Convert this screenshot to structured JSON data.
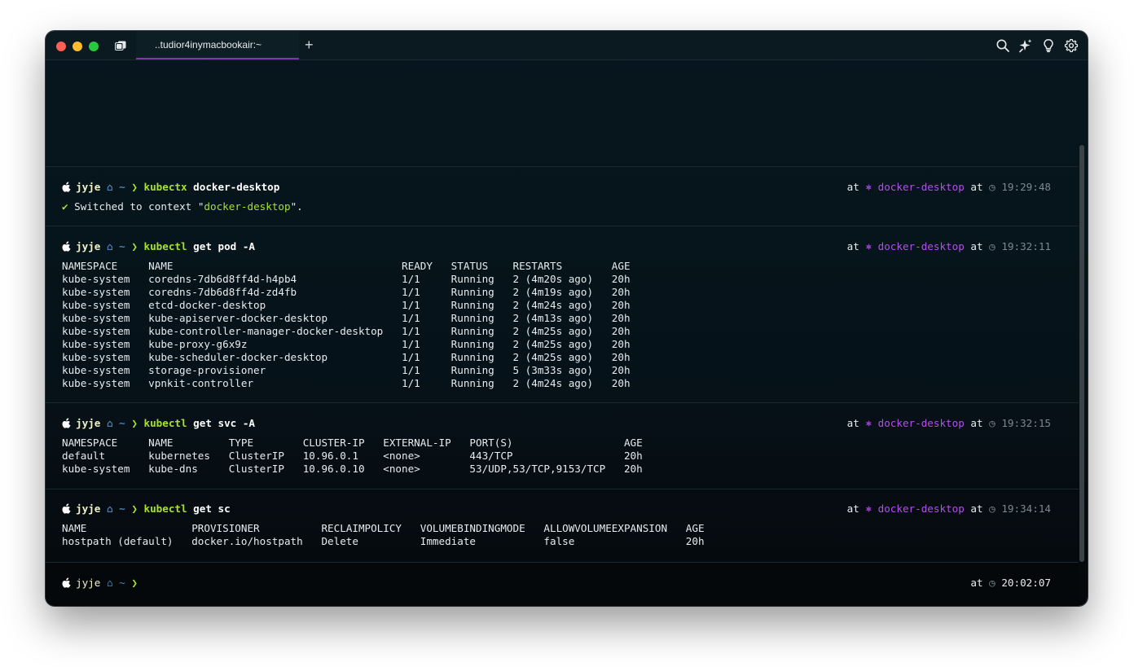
{
  "window": {
    "tab_title": "..tudior4inymacbookair:~",
    "new_tab_label": "+"
  },
  "toolbar_icons": [
    "search-icon",
    "sparkle-icon",
    "lightbulb-icon",
    "gear-icon"
  ],
  "colors": {
    "background": "#07171e",
    "prompt_user": "#f2f2c4",
    "command": "#a6e22e",
    "context": "#b350e8",
    "timestamp": "#7b8a90",
    "tab_underline": "#7c3aa6"
  },
  "prompt": {
    "user": "jyje",
    "home_glyph": "⌂",
    "tilde": "~",
    "chevron": "❯",
    "at": "at",
    "context_glyph": "⎈"
  },
  "blocks": [
    {
      "command": "kubectx",
      "args": "docker-desktop",
      "context": "docker-desktop",
      "time": "19:29:48",
      "output": {
        "check": "✔",
        "before": " Switched to context \"",
        "value": "docker-desktop",
        "after": "\"."
      }
    },
    {
      "command": "kubectl",
      "args": "get pod -A",
      "context": "docker-desktop",
      "time": "19:32:11",
      "lines": [
        "NAMESPACE     NAME                                     READY   STATUS    RESTARTS        AGE",
        "kube-system   coredns-7db6d8ff4d-h4pb4                 1/1     Running   2 (4m20s ago)   20h",
        "kube-system   coredns-7db6d8ff4d-zd4fb                 1/1     Running   2 (4m19s ago)   20h",
        "kube-system   etcd-docker-desktop                      1/1     Running   2 (4m24s ago)   20h",
        "kube-system   kube-apiserver-docker-desktop            1/1     Running   2 (4m13s ago)   20h",
        "kube-system   kube-controller-manager-docker-desktop   1/1     Running   2 (4m25s ago)   20h",
        "kube-system   kube-proxy-g6x9z                         1/1     Running   2 (4m25s ago)   20h",
        "kube-system   kube-scheduler-docker-desktop            1/1     Running   2 (4m25s ago)   20h",
        "kube-system   storage-provisioner                      1/1     Running   5 (3m33s ago)   20h",
        "kube-system   vpnkit-controller                        1/1     Running   2 (4m24s ago)   20h"
      ]
    },
    {
      "command": "kubectl",
      "args": "get svc -A",
      "context": "docker-desktop",
      "time": "19:32:15",
      "lines": [
        "NAMESPACE     NAME         TYPE        CLUSTER-IP   EXTERNAL-IP   PORT(S)                  AGE",
        "default       kubernetes   ClusterIP   10.96.0.1    <none>        443/TCP                  20h",
        "kube-system   kube-dns     ClusterIP   10.96.0.10   <none>        53/UDP,53/TCP,9153/TCP   20h"
      ]
    },
    {
      "command": "kubectl",
      "args": "get sc",
      "context": "docker-desktop",
      "time": "19:34:14",
      "lines": [
        "NAME                 PROVISIONER          RECLAIMPOLICY   VOLUMEBINDINGMODE   ALLOWVOLUMEEXPANSION   AGE",
        "hostpath (default)   docker.io/hostpath   Delete          Immediate           false                  20h"
      ]
    }
  ],
  "current_prompt": {
    "time": "20:02:07"
  }
}
